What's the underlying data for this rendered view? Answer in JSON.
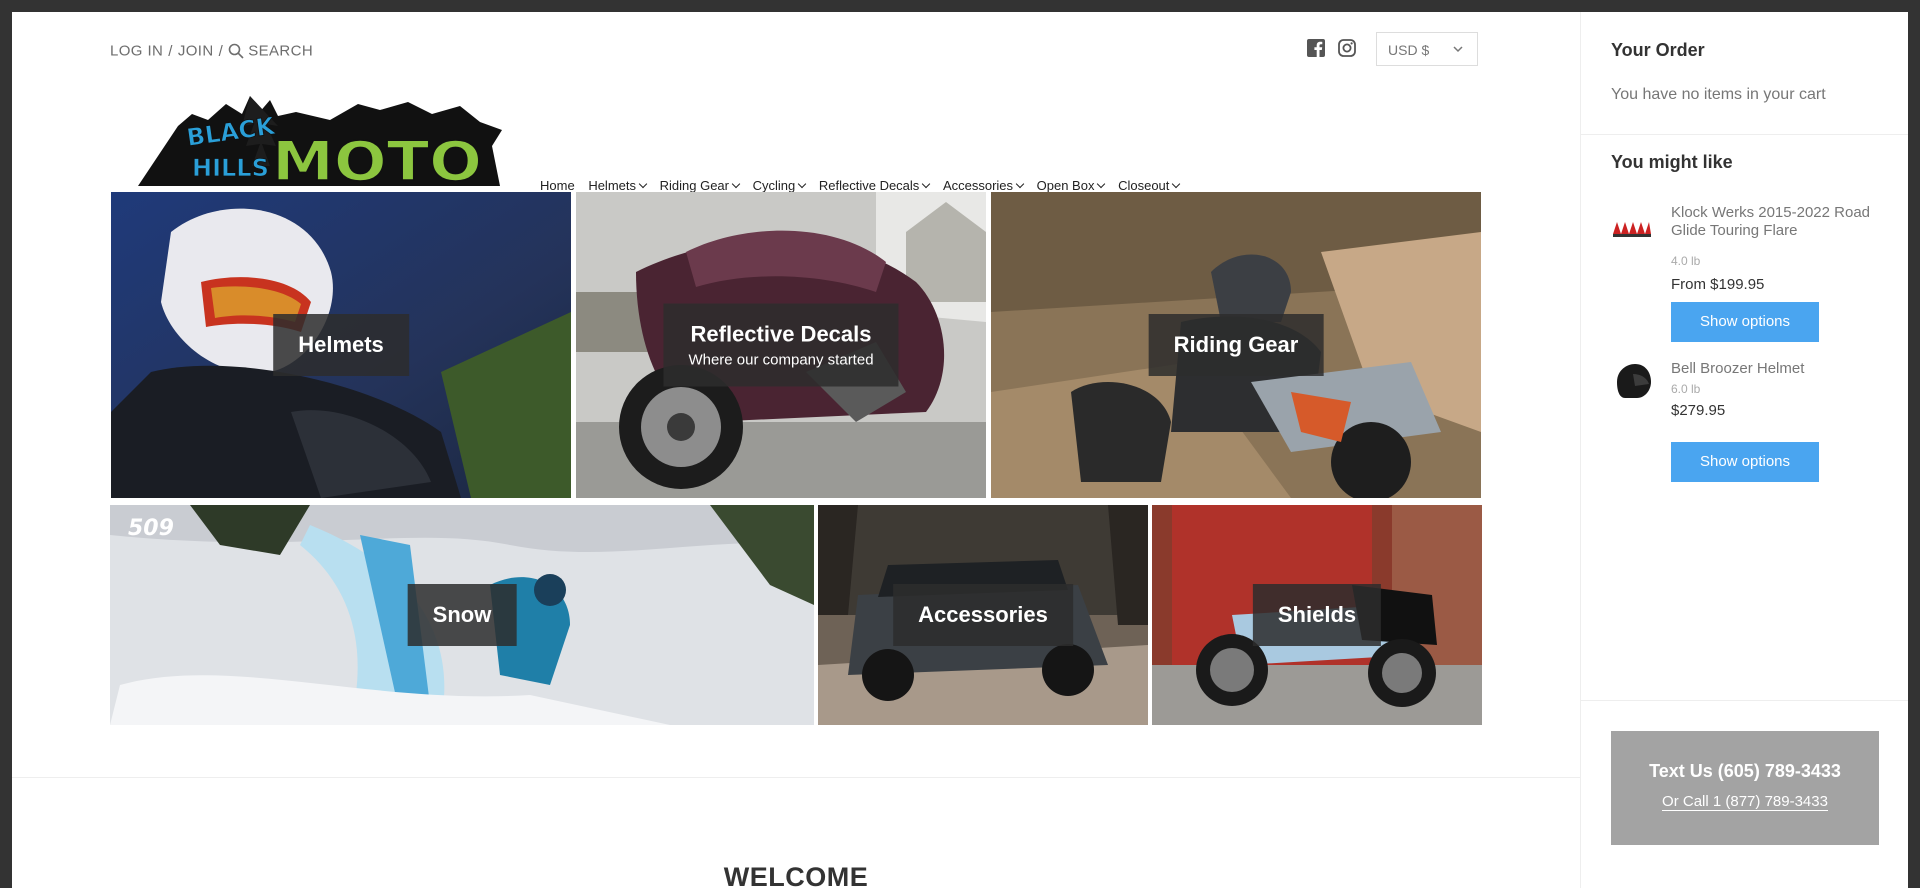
{
  "topbar": {
    "login": "LOG IN",
    "sep1": "/",
    "join": "JOIN",
    "sep2": "/",
    "search": "SEARCH"
  },
  "header": {
    "currency": "USD $",
    "logo_text": {
      "black": "BLACK",
      "hills": "HILLS",
      "moto": "MOTO"
    }
  },
  "nav": {
    "home": "Home",
    "helmets": "Helmets",
    "riding_gear": "Riding Gear",
    "cycling": "Cycling",
    "reflective_decals": "Reflective Decals",
    "accessories": "Accessories",
    "open_box": "Open Box",
    "closeout": "Closeout"
  },
  "tiles": {
    "helmets": {
      "title": "Helmets"
    },
    "reflective_decals": {
      "title": "Reflective Decals",
      "subtitle": "Where our company started"
    },
    "riding_gear": {
      "title": "Riding Gear"
    },
    "snow": {
      "title": "Snow"
    },
    "accessories": {
      "title": "Accessories"
    },
    "shields": {
      "title": "Shields"
    }
  },
  "welcome": "WELCOME",
  "sidebar": {
    "order_title": "Your Order",
    "empty_text": "You have no items in your cart",
    "suggest_title": "You might like",
    "products": [
      {
        "name": "Klock Werks 2015-2022 Road Glide Touring Flare",
        "weight": "4.0 lb",
        "price_prefix": "From",
        "price": "$199.95",
        "button": "Show options"
      },
      {
        "name": "Bell Broozer Helmet",
        "weight": "6.0 lb",
        "price": "$279.95",
        "button": "Show options"
      }
    ],
    "contact": {
      "text_line": "Text Us (605) 789-3433",
      "call_line": "Or Call 1 (877) 789-3433"
    }
  },
  "colors": {
    "accent": "#4aa5f0",
    "logo_green": "#8cc63f",
    "logo_blue": "#2a9fd8",
    "frame": "#333333"
  }
}
